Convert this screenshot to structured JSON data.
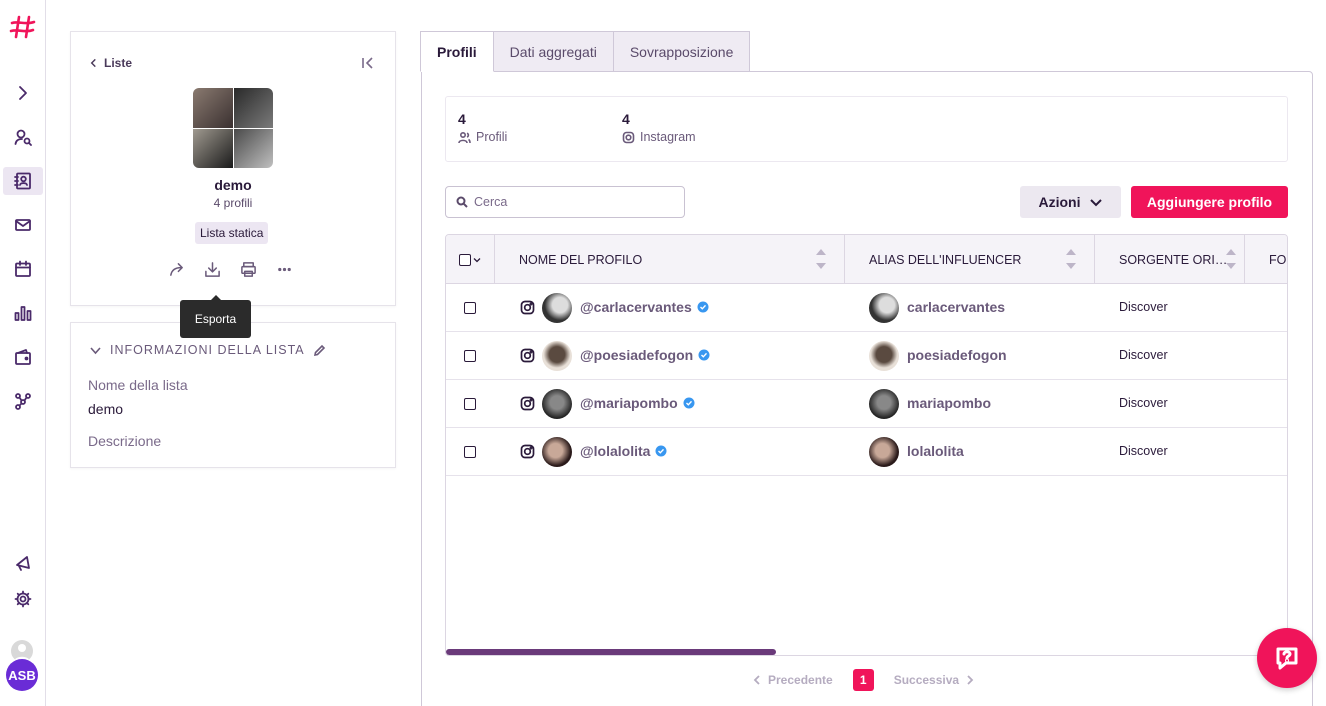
{
  "sidebar": {
    "icons": [
      "logo-icon",
      "expand-icon",
      "user-search-icon",
      "contacts-icon",
      "mail-icon",
      "calendar-icon",
      "chart-icon",
      "wallet-icon",
      "network-icon",
      "megaphone-icon",
      "gear-icon"
    ],
    "user_initials": "ASB"
  },
  "list_card": {
    "back_label": "Liste",
    "name": "demo",
    "count": "4 profili",
    "badge": "Lista statica",
    "tooltip": "Esporta"
  },
  "info_card": {
    "header": "INFORMAZIONI DELLA LISTA",
    "name_label": "Nome della lista",
    "name_value": "demo",
    "description_label": "Descrizione"
  },
  "tabs": [
    {
      "label": "Profili",
      "active": true
    },
    {
      "label": "Dati aggregati",
      "active": false
    },
    {
      "label": "Sovrapposizione",
      "active": false
    }
  ],
  "stats": {
    "profiles_count": "4",
    "profiles_label": "Profili",
    "instagram_count": "4",
    "instagram_label": "Instagram"
  },
  "toolbar": {
    "search_placeholder": "Cerca",
    "actions_label": "Azioni",
    "add_label": "Aggiungere profilo"
  },
  "table": {
    "columns": [
      "NOME DEL PROFILO",
      "ALIAS DELL'INFLUENCER",
      "SORGENTE ORI…",
      "FO"
    ],
    "rows": [
      {
        "handle": "@carlacervantes",
        "alias": "carlacervantes",
        "source": "Discover"
      },
      {
        "handle": "@poesiadefogon",
        "alias": "poesiadefogon",
        "source": "Discover"
      },
      {
        "handle": "@mariapombo",
        "alias": "mariapombo",
        "source": "Discover"
      },
      {
        "handle": "@lolalolita",
        "alias": "lolalolita",
        "source": "Discover"
      }
    ]
  },
  "pagination": {
    "prev": "Precedente",
    "page": "1",
    "next": "Successiva"
  },
  "colors": {
    "accent": "#f0145a",
    "primary_text": "#2a1a3a",
    "user_badge": "#6a2cd6"
  }
}
